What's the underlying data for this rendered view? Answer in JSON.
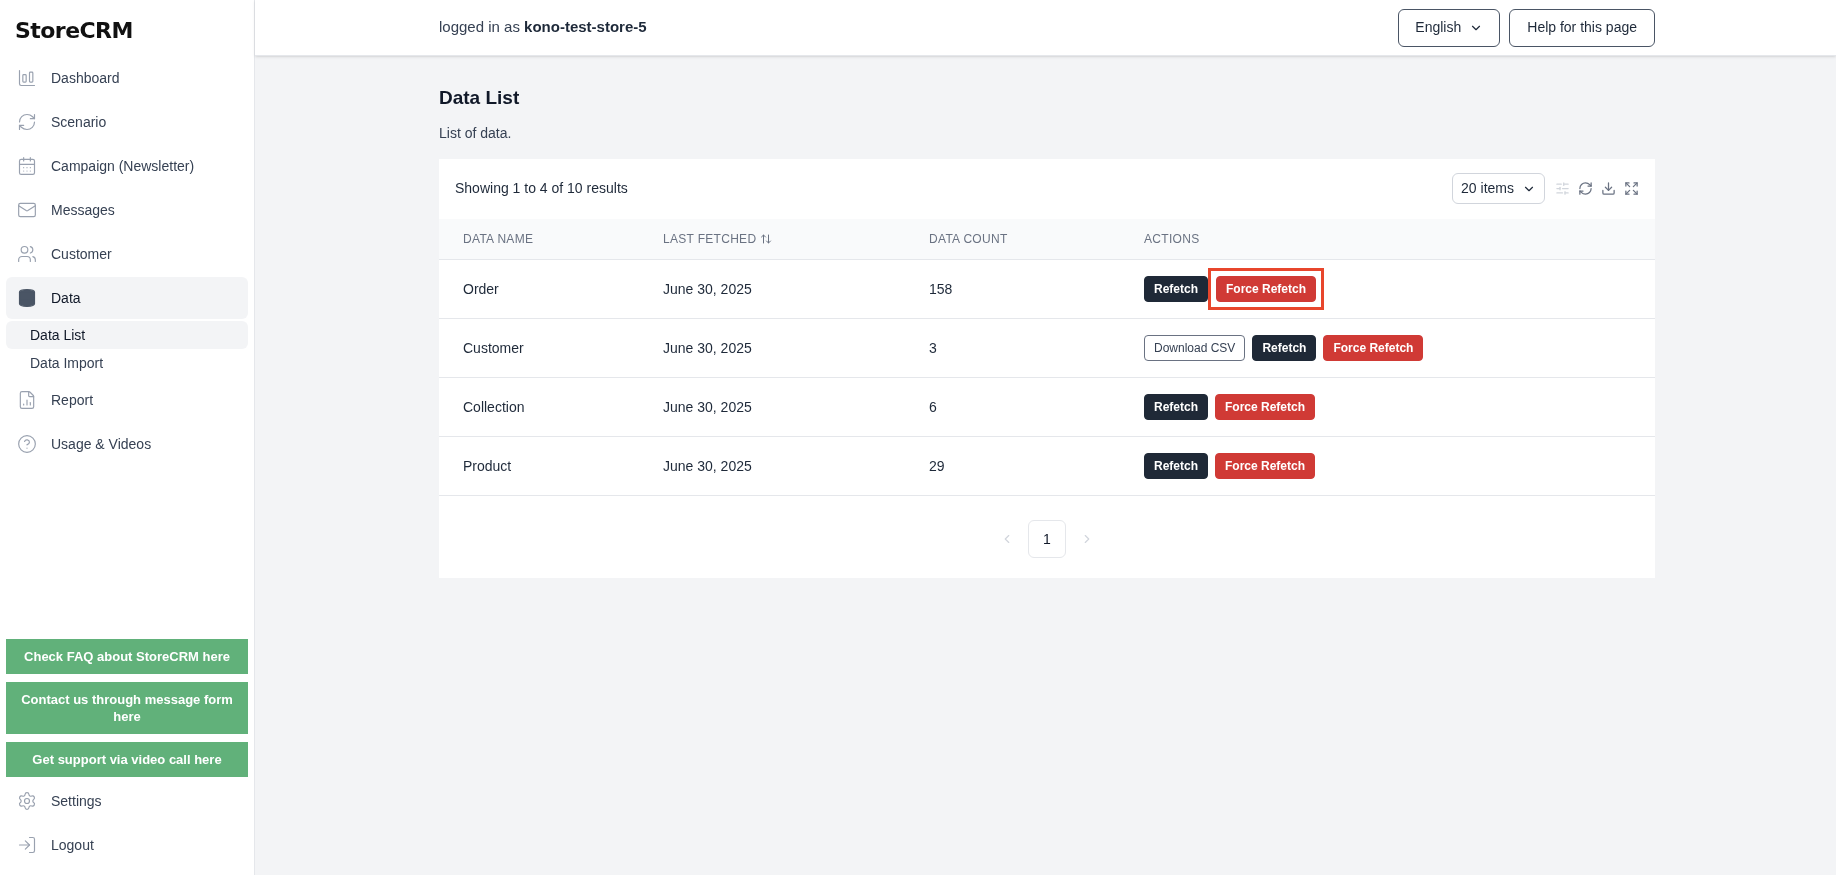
{
  "app": {
    "logo": "StoreCRM"
  },
  "sidebar": {
    "items": [
      {
        "kind": "dashboard",
        "label": "Dashboard",
        "selected": false
      },
      {
        "kind": "scenario",
        "label": "Scenario",
        "selected": false
      },
      {
        "kind": "campaign",
        "label": "Campaign (Newsletter)",
        "selected": false
      },
      {
        "kind": "messages",
        "label": "Messages",
        "selected": false
      },
      {
        "kind": "customer",
        "label": "Customer",
        "selected": false
      },
      {
        "kind": "data",
        "label": "Data",
        "selected": true,
        "children": [
          {
            "label": "Data List",
            "selected": true
          },
          {
            "label": "Data Import",
            "selected": false
          }
        ]
      },
      {
        "kind": "report",
        "label": "Report",
        "selected": false
      },
      {
        "kind": "help",
        "label": "Usage & Videos",
        "selected": false
      }
    ],
    "support_buttons": [
      "Check FAQ about StoreCRM here",
      "Contact us through message form here",
      "Get support via video call here"
    ],
    "bottom_items": [
      {
        "kind": "settings",
        "label": "Settings"
      },
      {
        "kind": "logout",
        "label": "Logout"
      }
    ]
  },
  "header": {
    "login_prefix": "logged in as",
    "user": "kono-test-store-5",
    "language": "English",
    "help_button": "Help for this page"
  },
  "page": {
    "title": "Data List",
    "subtitle": "List of data."
  },
  "table": {
    "summary": "Showing 1 to 4 of 10 results",
    "page_size": "20 items",
    "columns": [
      {
        "label": "DATA NAME",
        "sortable": false
      },
      {
        "label": "LAST FETCHED",
        "sortable": true
      },
      {
        "label": "DATA COUNT",
        "sortable": false
      },
      {
        "label": "ACTIONS",
        "sortable": false
      }
    ],
    "rows": [
      {
        "name": "Order",
        "last_fetched": "June 30, 2025",
        "count": "158",
        "actions": [
          {
            "kind": "refetch",
            "label": "Refetch",
            "highlighted": false
          },
          {
            "kind": "force",
            "label": "Force Refetch",
            "highlighted": true
          }
        ]
      },
      {
        "name": "Customer",
        "last_fetched": "June 30, 2025",
        "count": "3",
        "actions": [
          {
            "kind": "download",
            "label": "Download CSV",
            "highlighted": false
          },
          {
            "kind": "refetch",
            "label": "Refetch",
            "highlighted": false
          },
          {
            "kind": "force",
            "label": "Force Refetch",
            "highlighted": false
          }
        ]
      },
      {
        "name": "Collection",
        "last_fetched": "June 30, 2025",
        "count": "6",
        "actions": [
          {
            "kind": "refetch",
            "label": "Refetch",
            "highlighted": false
          },
          {
            "kind": "force",
            "label": "Force Refetch",
            "highlighted": false
          }
        ]
      },
      {
        "name": "Product",
        "last_fetched": "June 30, 2025",
        "count": "29",
        "actions": [
          {
            "kind": "refetch",
            "label": "Refetch",
            "highlighted": false
          },
          {
            "kind": "force",
            "label": "Force Refetch",
            "highlighted": false
          }
        ]
      }
    ],
    "pagination": {
      "pages": [
        {
          "label": "1",
          "selected": true
        }
      ]
    }
  }
}
